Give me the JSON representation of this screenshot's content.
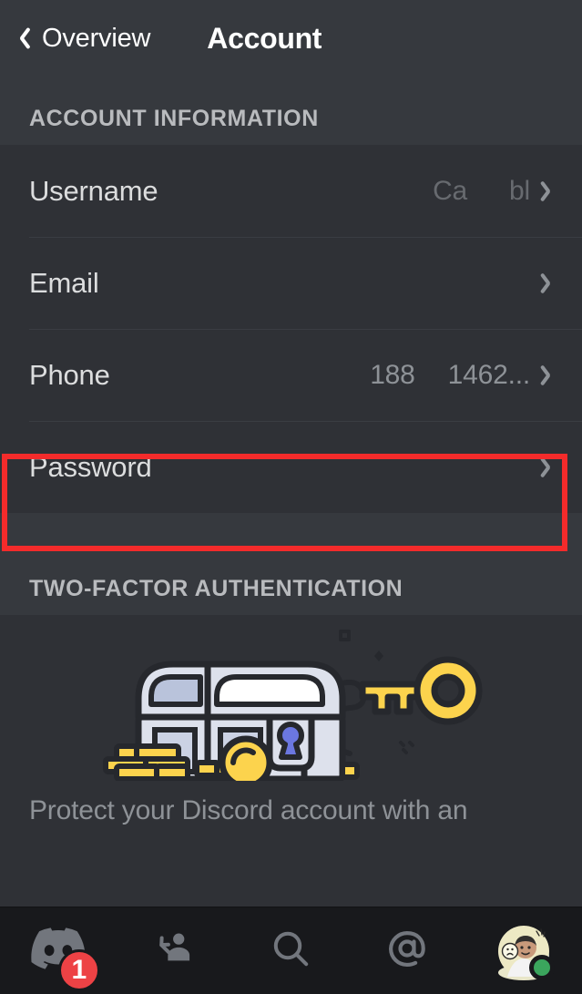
{
  "header": {
    "back_label": "Overview",
    "title": "Account",
    "back_icon": "chevron-left-icon"
  },
  "sections": [
    {
      "id": "account-information",
      "label": "ACCOUNT INFORMATION",
      "rows": [
        {
          "id": "username",
          "label": "Username",
          "value_parts": [
            "Ca",
            "bl"
          ],
          "redacted": true,
          "chevron": "chevron-right-icon"
        },
        {
          "id": "email",
          "label": "Email",
          "value_parts": [],
          "redacted": false,
          "chevron": "chevron-right-icon"
        },
        {
          "id": "phone",
          "label": "Phone",
          "value_parts": [
            "188",
            "1462..."
          ],
          "redacted": false,
          "highlighted": true,
          "chevron": "chevron-right-icon"
        },
        {
          "id": "password",
          "label": "Password",
          "value_parts": [],
          "redacted": false,
          "chevron": "chevron-right-icon"
        }
      ]
    },
    {
      "id": "two-factor-authentication",
      "label": "TWO-FACTOR AUTHENTICATION",
      "promo": {
        "illustration": "treasure-chest-with-key-illustration",
        "text": "Protect your Discord account with an"
      }
    }
  ],
  "annotation": {
    "target": "phone-row",
    "color": "#F42B2B",
    "shape": "rectangle"
  },
  "navbar": {
    "items": [
      {
        "id": "servers",
        "icon": "discord-logo-icon",
        "badge": "1"
      },
      {
        "id": "friends",
        "icon": "friends-icon",
        "badge": null
      },
      {
        "id": "search",
        "icon": "search-icon",
        "badge": null
      },
      {
        "id": "mentions",
        "icon": "mention-at-icon",
        "badge": null
      },
      {
        "id": "profile",
        "icon": "avatar-icon",
        "badge": null,
        "status": "online"
      }
    ]
  },
  "colors": {
    "background": "#2F3136",
    "section_header_background": "#36393E",
    "navbar_background": "#18191C",
    "accent_red": "#ED4245",
    "annotation_red": "#F42B2B",
    "text_primary": "#DCDDDE",
    "text_secondary": "#8E9297",
    "status_online": "#3BA55D",
    "gold": "#FCD34D",
    "chest": "#DDE1EC",
    "keyhole_blue": "#6B77E0"
  }
}
